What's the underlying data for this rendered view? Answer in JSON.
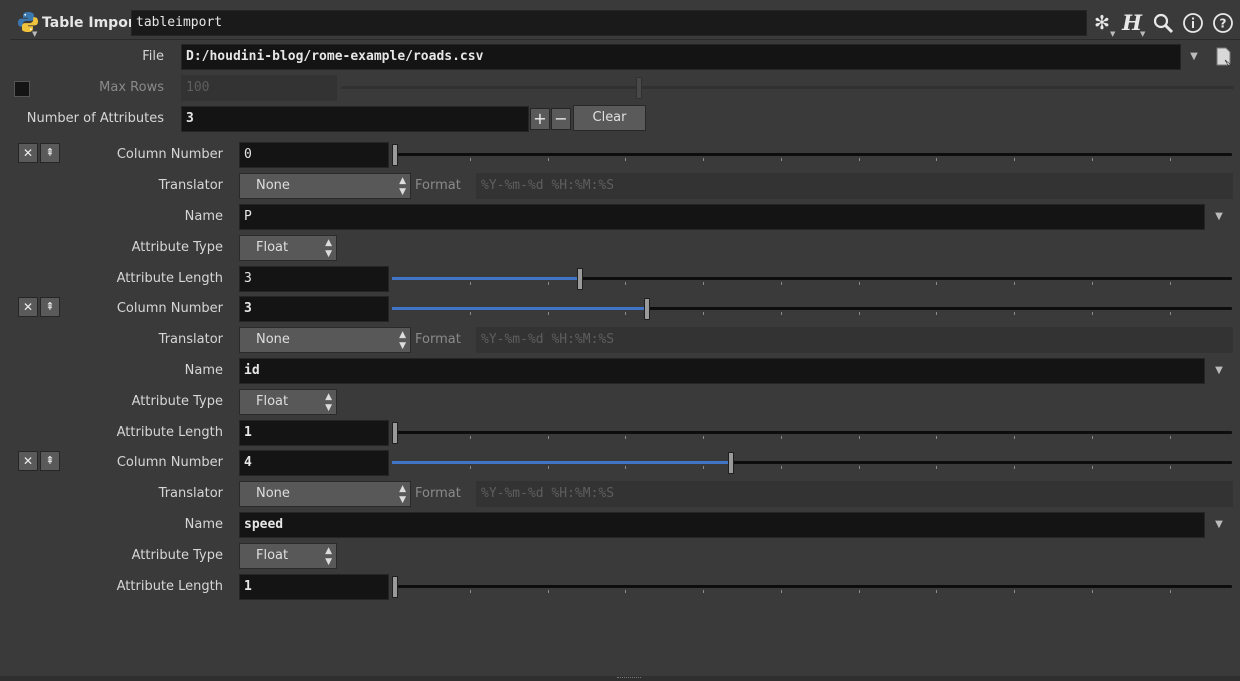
{
  "header": {
    "node_type": "Table Import",
    "node_name": "tableimport"
  },
  "file": {
    "label": "File",
    "value": "D:/houdini-blog/rome-example/roads.csv"
  },
  "max_rows": {
    "label": "Max Rows",
    "value": "100",
    "enabled": false
  },
  "num_attributes": {
    "label": "Number of Attributes",
    "value": "3",
    "add": "+",
    "remove": "−",
    "clear_label": "Clear"
  },
  "labels": {
    "column_number": "Column Number",
    "translator": "Translator",
    "format": "Format",
    "name": "Name",
    "attribute_type": "Attribute Type",
    "attribute_length": "Attribute Length"
  },
  "attributes": [
    {
      "column_number": "0",
      "column_fraction": 0.0,
      "translator": "None",
      "format": "%Y-%m-%d %H:%M:%S",
      "name": "P",
      "attribute_type": "Float",
      "attribute_length": "3",
      "length_fraction": 0.22
    },
    {
      "column_number": "3",
      "column_fraction": 0.3,
      "translator": "None",
      "format": "%Y-%m-%d %H:%M:%S",
      "name": "id",
      "attribute_type": "Float",
      "attribute_length": "1",
      "length_fraction": 0.0
    },
    {
      "column_number": "4",
      "column_fraction": 0.4,
      "translator": "None",
      "format": "%Y-%m-%d %H:%M:%S",
      "name": "speed",
      "attribute_type": "Float",
      "attribute_length": "1",
      "length_fraction": 0.0
    }
  ],
  "icons": {
    "node": "python-icon",
    "gear": "gear-icon",
    "houdini": "houdini-help-icon",
    "search": "search-icon",
    "info": "info-icon",
    "help": "help-icon",
    "remove_entry": "close-icon",
    "insert_entry": "insert-icon",
    "file_chooser": "file-chooser-icon"
  },
  "colors": {
    "background": "#3a3a3a",
    "field": "#141414",
    "slider_fill": "#3f74c7"
  }
}
